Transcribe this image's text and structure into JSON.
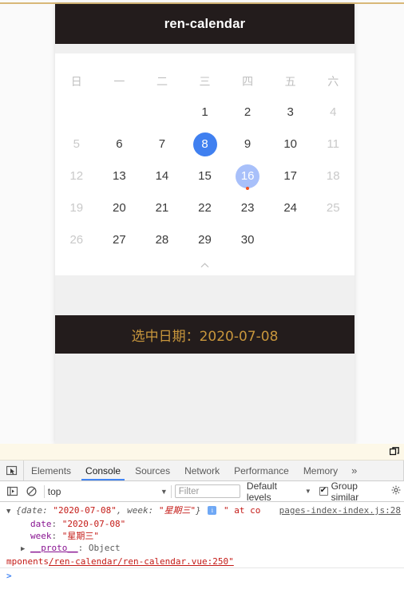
{
  "app": {
    "title": "ren-calendar",
    "weekdays": [
      "日",
      "一",
      "二",
      "三",
      "四",
      "五",
      "六"
    ],
    "weeks": [
      [
        {
          "label": "",
          "type": "empty"
        },
        {
          "label": "",
          "type": "empty"
        },
        {
          "label": "",
          "type": "empty"
        },
        {
          "label": "1",
          "type": "normal"
        },
        {
          "label": "2",
          "type": "normal"
        },
        {
          "label": "3",
          "type": "normal"
        },
        {
          "label": "4",
          "type": "weekend"
        }
      ],
      [
        {
          "label": "5",
          "type": "weekend"
        },
        {
          "label": "6",
          "type": "normal"
        },
        {
          "label": "7",
          "type": "normal"
        },
        {
          "label": "8",
          "type": "selected"
        },
        {
          "label": "9",
          "type": "normal"
        },
        {
          "label": "10",
          "type": "normal"
        },
        {
          "label": "11",
          "type": "weekend"
        }
      ],
      [
        {
          "label": "12",
          "type": "weekend"
        },
        {
          "label": "13",
          "type": "normal"
        },
        {
          "label": "14",
          "type": "normal"
        },
        {
          "label": "15",
          "type": "normal"
        },
        {
          "label": "16",
          "type": "today",
          "dot": true
        },
        {
          "label": "17",
          "type": "normal"
        },
        {
          "label": "18",
          "type": "weekend"
        }
      ],
      [
        {
          "label": "19",
          "type": "weekend"
        },
        {
          "label": "20",
          "type": "normal"
        },
        {
          "label": "21",
          "type": "normal"
        },
        {
          "label": "22",
          "type": "normal"
        },
        {
          "label": "23",
          "type": "normal"
        },
        {
          "label": "24",
          "type": "normal"
        },
        {
          "label": "25",
          "type": "weekend"
        }
      ],
      [
        {
          "label": "26",
          "type": "weekend"
        },
        {
          "label": "27",
          "type": "normal"
        },
        {
          "label": "28",
          "type": "normal"
        },
        {
          "label": "29",
          "type": "normal"
        },
        {
          "label": "30",
          "type": "normal"
        },
        {
          "label": "",
          "type": "empty"
        },
        {
          "label": "",
          "type": "empty"
        }
      ]
    ],
    "collapse_icon": "chevron-up-icon",
    "result_label": "选中日期：2020-07-08",
    "colors": {
      "header_bg": "#231c1c",
      "selected": "#4080f0",
      "today": "#a8c0fa",
      "dot": "#f4511e",
      "result_text": "#c8963c"
    }
  },
  "devtools": {
    "dock_icon": "dock-window-icon",
    "inspect_icon": "inspect-element-icon",
    "tabs": [
      {
        "label": "Elements",
        "active": false
      },
      {
        "label": "Console",
        "active": true
      },
      {
        "label": "Sources",
        "active": false
      },
      {
        "label": "Network",
        "active": false
      },
      {
        "label": "Performance",
        "active": false
      },
      {
        "label": "Memory",
        "active": false
      }
    ],
    "more_tabs_label": "»",
    "toolbar": {
      "sidebar_icon": "show-console-sidebar-icon",
      "clear_icon": "clear-console-icon",
      "context": "top",
      "context_caret": "▼",
      "filter_placeholder": "Filter",
      "levels_label": "Default levels",
      "levels_caret": "▼",
      "group_similar_label": "Group similar",
      "group_similar_checked": true,
      "settings_icon": "console-settings-icon"
    },
    "console": {
      "entry": {
        "expander": "▼",
        "object_open": "{",
        "key_date": "date",
        "colon": ": ",
        "val_date": "\"2020-07-08\"",
        "comma": ", ",
        "key_week": "week",
        "val_week": "\"星期三\"",
        "object_close": "}",
        "info_icon": "info-icon",
        "info_glyph": "i",
        "trailing": "\" at co",
        "source_link": "pages-index-index.js:28"
      },
      "props": [
        {
          "key": "date",
          "value": "\"2020-07-08\""
        },
        {
          "key": "week",
          "value": "\"星期三\""
        }
      ],
      "proto": {
        "expander": "▶",
        "key": "__proto__",
        "value": "Object"
      },
      "wrapped_line": {
        "prefix": "mponents",
        "link": "/ren-calendar/ren-calendar.vue:250\""
      },
      "prompt": ">"
    }
  }
}
